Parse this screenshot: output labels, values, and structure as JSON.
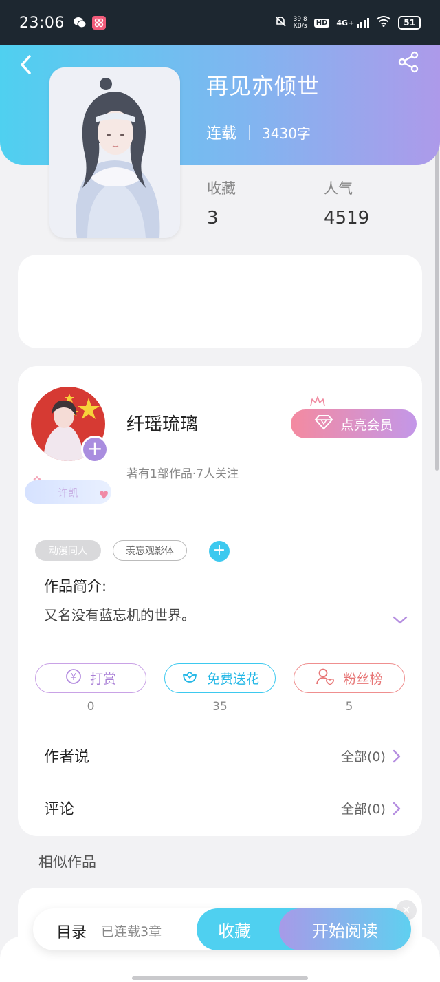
{
  "status_bar": {
    "time": "23:06",
    "net_speed_value": "39.8",
    "net_speed_unit": "KB/s",
    "hd": "HD",
    "network": "4G+",
    "battery": "51"
  },
  "book": {
    "title": "再见亦倾世",
    "status": "连载",
    "word_count": "3430字",
    "favorites_label": "收藏",
    "favorites_value": "3",
    "popularity_label": "人气",
    "popularity_value": "4519"
  },
  "author": {
    "name": "纤瑶琉璃",
    "meta": "著有1部作品·7人关注",
    "badge": "许凯",
    "vip_button": "点亮会员"
  },
  "tags": [
    "动漫同人",
    "羡忘观影体"
  ],
  "intro": {
    "label": "作品简介:",
    "text": "又名没有蓝忘机的世界。"
  },
  "actions": [
    {
      "label": "打赏",
      "icon": "yen-coin-icon",
      "count": "0"
    },
    {
      "label": "免费送花",
      "icon": "flower-icon",
      "count": "35"
    },
    {
      "label": "粉丝榜",
      "icon": "fans-heart-icon",
      "count": "5"
    }
  ],
  "sections": {
    "author_says": {
      "label": "作者说",
      "link": "全部(0)"
    },
    "comments": {
      "label": "评论",
      "link": "全部(0)"
    }
  },
  "similar": {
    "title": "相似作品"
  },
  "bottom_bar": {
    "toc_label": "目录",
    "toc_count": "已连载3章",
    "favorite_button": "收藏",
    "read_button": "开始阅读"
  },
  "colors": {
    "header_gradient_start": "#4fd0f0",
    "header_gradient_end": "#ad9aea",
    "accent_cyan": "#3dc9ef",
    "accent_purple": "#a98ddf",
    "vip_pink": "#f48aa0"
  }
}
